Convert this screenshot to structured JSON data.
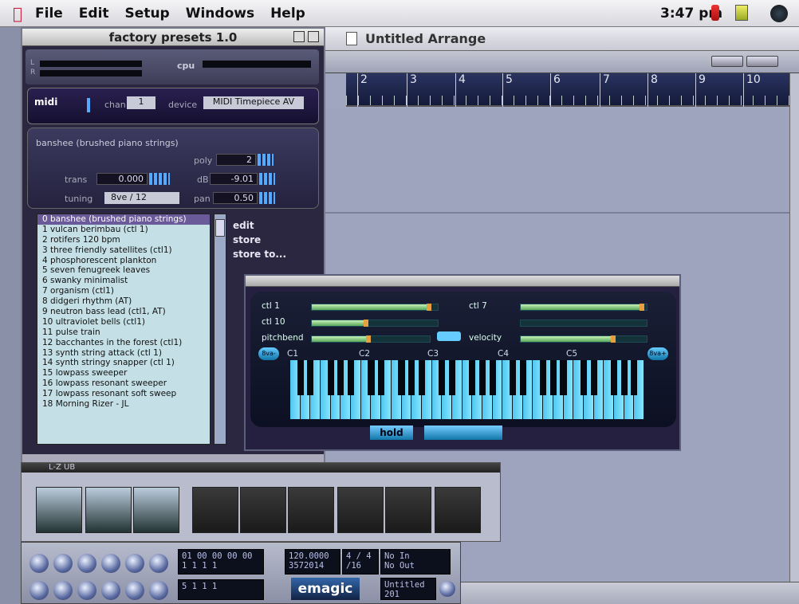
{
  "menubar": {
    "apple": "",
    "items": [
      "File",
      "Edit",
      "Setup",
      "Windows",
      "Help"
    ],
    "clock": "3:47 pm"
  },
  "arrange": {
    "title": "Untitled Arrange",
    "bars": [
      "2",
      "3",
      "4",
      "5",
      "6",
      "7",
      "8",
      "9",
      "10"
    ]
  },
  "presets": {
    "title": "factory presets 1.0",
    "cpu_label": "cpu",
    "meter_l": "L",
    "meter_r": "R",
    "midi_label": "midi",
    "chan_label": "chan",
    "chan_value": "1",
    "device_label": "device",
    "device_value": "MIDI Timepiece AV",
    "patch_name": "banshee (brushed piano strings)",
    "poly_label": "poly",
    "poly_value": "2",
    "trans_label": "trans",
    "trans_value": "0.000",
    "db_label": "dB",
    "db_value": "-9.01",
    "tuning_label": "tuning",
    "tuning_value": "8ve / 12",
    "pan_label": "pan",
    "pan_value": "0.50",
    "selected_index": 0,
    "list": [
      "0 banshee (brushed piano strings)",
      "1 vulcan berimbau   (ctl 1)",
      "2 rotifers 120 bpm",
      "3 three friendly satellites (ctl1)",
      "4 phosphorescent plankton",
      "5 seven fenugreek leaves",
      "6 swanky minimalist",
      "7 organism   (ctl1)",
      "8 didgeri rhythm   (AT)",
      "9 neutron bass lead   (ctl1, AT)",
      "10 ultraviolet bells   (ctl1)",
      "11 pulse train",
      "12 bacchantes in the forest (ctl1)",
      "13 synth string attack (ctl 1)",
      "14 synth stringy snapper (ctl 1)",
      "15 lowpass sweeper",
      "16 lowpass resonant sweeper",
      "17 lowpass resonant soft sweep",
      "18 Morning Rizer - JL"
    ],
    "commands": [
      "edit",
      "store",
      "store to..."
    ]
  },
  "keyboard": {
    "ctl1_label": "ctl 1",
    "ctl10_label": "ctl 10",
    "pitchbend_label": "pitchbend",
    "ctl7_label": "ctl 7",
    "velocity_label": "velocity",
    "ctl1_level": 0.95,
    "ctl10_level": 0.45,
    "pitchbend_level": 0.5,
    "ctl7_level": 0.98,
    "velocity_level": 0.75,
    "octaves": [
      "C1",
      "C2",
      "C3",
      "C4",
      "C5"
    ],
    "oct_down": "8va-",
    "oct_up": "8va+",
    "hold_label": "hold",
    "key_color": "#5fd0f5"
  },
  "thumbwin": {
    "title": "L-Z  UB"
  },
  "transport": {
    "position_top": "01 00 00 00 00",
    "position_bottom": "1  1  1  1",
    "locator_bottom": "5  1  1  1",
    "tempo": "120.0000",
    "samples": "3572014",
    "signature": "4 / 4",
    "division": "/16",
    "no_in": "No In",
    "no_out": "No Out",
    "song_name": "Untitled",
    "song_pos": "201",
    "brand": "emagic"
  }
}
